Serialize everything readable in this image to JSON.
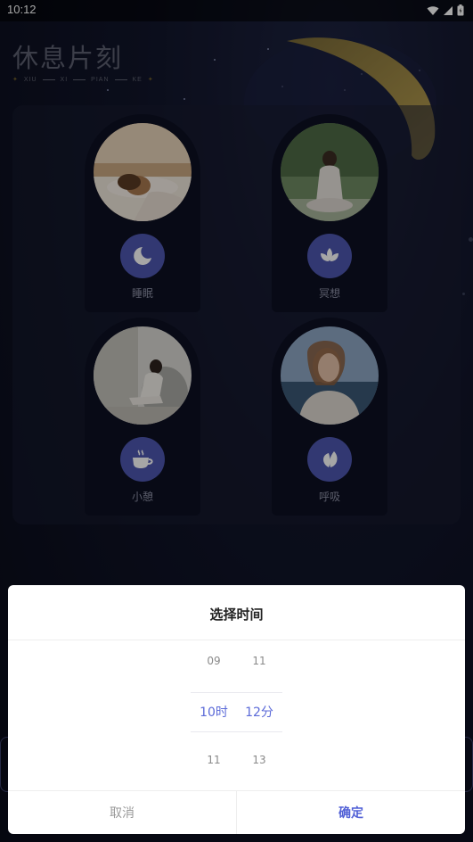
{
  "status_bar": {
    "time": "10:12"
  },
  "logo": {
    "title": "休息片刻",
    "sub": [
      "XIU",
      "XI",
      "PIAN",
      "KE"
    ]
  },
  "tiles": [
    {
      "label": "睡眠",
      "icon": "moon-sleep-icon"
    },
    {
      "label": "冥想",
      "icon": "lotus-icon"
    },
    {
      "label": "小憩",
      "icon": "coffee-cup-icon"
    },
    {
      "label": "呼吸",
      "icon": "leaf-icon"
    }
  ],
  "dialog": {
    "title": "选择时间",
    "hour": {
      "prev": "09",
      "selected": "10时",
      "next": "11"
    },
    "minute": {
      "prev": "11",
      "selected": "12分",
      "next": "13"
    },
    "cancel": "取消",
    "confirm": "确定"
  },
  "colors": {
    "accent": "#5160d6",
    "icon_circle": "#4e57b0",
    "moon": "#c9ad4e",
    "background": "#0c0f1f"
  }
}
